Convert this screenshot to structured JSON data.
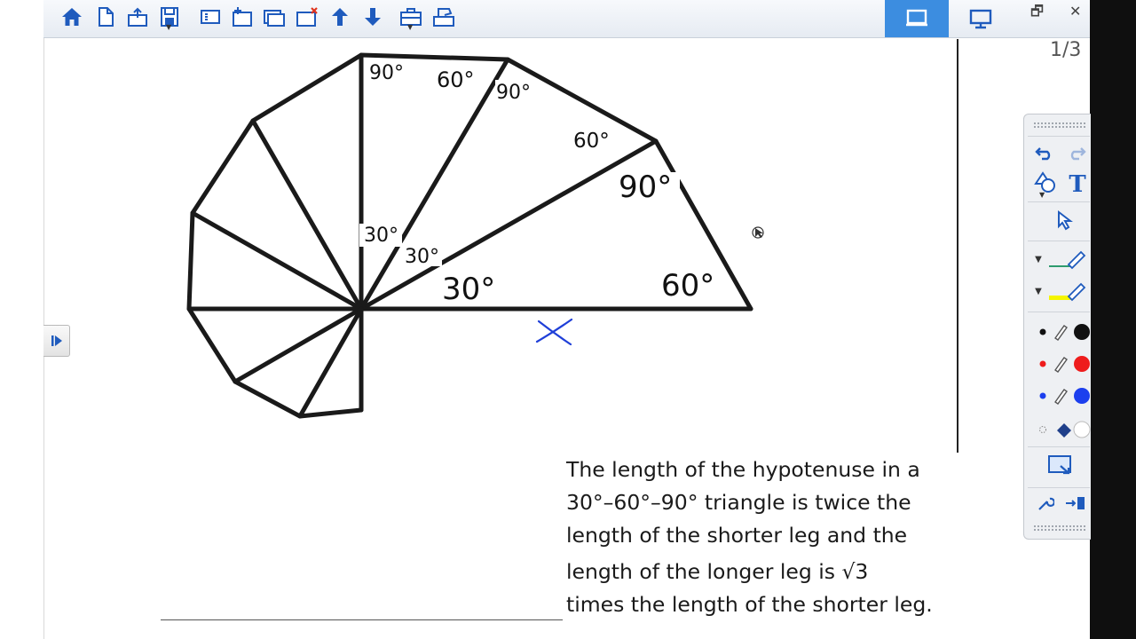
{
  "toolbar": {
    "buttons": [
      "home-icon",
      "new-page-icon",
      "open-icon",
      "save-icon",
      "view-icon",
      "add-page-icon",
      "duplicate-page-icon",
      "delete-page-icon",
      "previous-page-icon",
      "next-page-icon",
      "toolbox-icon",
      "screen-capture-icon"
    ]
  },
  "window": {
    "restore_glyph": "🗗",
    "close_glyph": "✕"
  },
  "page": {
    "counter": "1/3"
  },
  "diagram": {
    "angles": {
      "top_90": "90°",
      "top_60": "60°",
      "mid_90": "90°",
      "mid_60": "60°",
      "big_90": "90°",
      "left_30": "30°",
      "center_30": "30°",
      "base_30": "30°",
      "base_60": "60°"
    },
    "unknown_label": "X",
    "stroke_color": "#1a1a1a",
    "ink_color": "#1f3fd8"
  },
  "theorem": {
    "line1": "The length of the hypotenuse in a",
    "line2": "30°–60°–90° triangle is twice the",
    "line3": "length of the shorter leg and the",
    "line4": "length of the longer leg is √3",
    "line5": "times the length of the shorter leg."
  },
  "palette": {
    "colors": {
      "black": "#111111",
      "red": "#ee1c1c",
      "blue": "#1c3fee",
      "highlighter": "#f5f500",
      "pen_green": "#2e9b6e"
    }
  }
}
